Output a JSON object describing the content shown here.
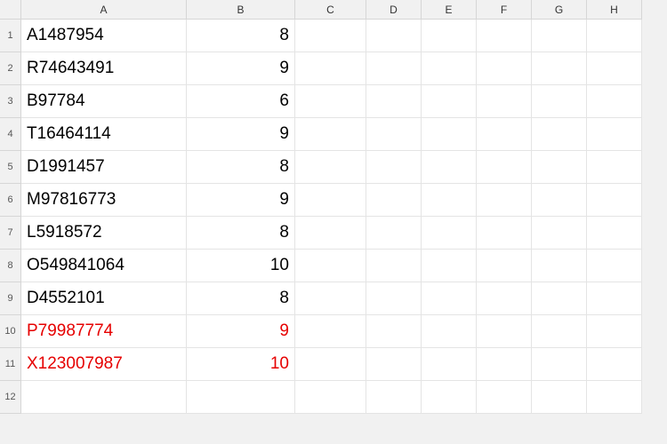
{
  "columns": [
    "A",
    "B",
    "C",
    "D",
    "E",
    "F",
    "G",
    "H"
  ],
  "rowCount": 12,
  "rows": [
    {
      "a": "A1487954",
      "b": "8",
      "red": false
    },
    {
      "a": "R74643491",
      "b": "9",
      "red": false
    },
    {
      "a": "B97784",
      "b": "6",
      "red": false
    },
    {
      "a": "T16464114",
      "b": "9",
      "red": false
    },
    {
      "a": "D1991457",
      "b": "8",
      "red": false
    },
    {
      "a": "M97816773",
      "b": "9",
      "red": false
    },
    {
      "a": "L5918572",
      "b": "8",
      "red": false
    },
    {
      "a": "O549841064",
      "b": "10",
      "red": false
    },
    {
      "a": "D4552101",
      "b": "8",
      "red": false
    },
    {
      "a": "P79987774",
      "b": "9",
      "red": true
    },
    {
      "a": "X123007987",
      "b": "10",
      "red": true
    },
    {
      "a": "",
      "b": "",
      "red": false
    }
  ],
  "colors": {
    "highlight": "#e60000"
  }
}
